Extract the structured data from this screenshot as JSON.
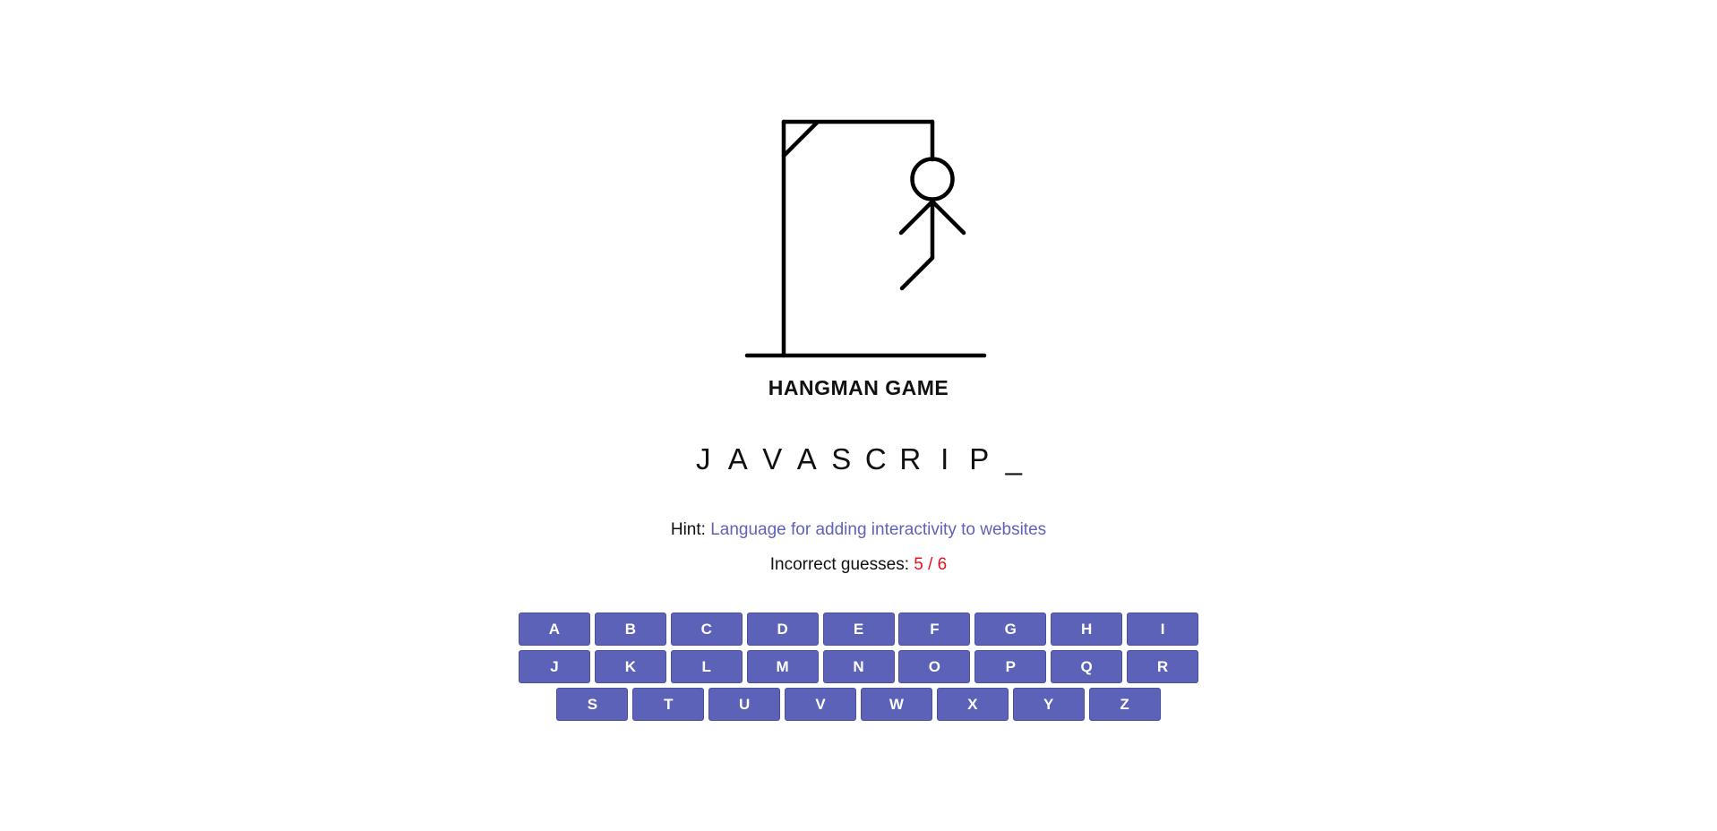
{
  "title": "HANGMAN GAME",
  "word": [
    "J",
    "A",
    "V",
    "A",
    "S",
    "C",
    "R",
    "I",
    "P",
    "_"
  ],
  "hint": {
    "label": "Hint:",
    "text": "Language for adding interactivity to websites"
  },
  "guesses": {
    "label": "Incorrect guesses:",
    "value": "5 / 6"
  },
  "keyboard": {
    "rows": [
      [
        "A",
        "B",
        "C",
        "D",
        "E",
        "F",
        "G",
        "H",
        "I"
      ],
      [
        "J",
        "K",
        "L",
        "M",
        "N",
        "O",
        "P",
        "Q",
        "R"
      ],
      [
        "S",
        "T",
        "U",
        "V",
        "W",
        "X",
        "Y",
        "Z"
      ]
    ]
  },
  "colors": {
    "key_background": "#5d62b9",
    "hint_text": "#5e63b8",
    "incorrect_count": "#e8101a"
  }
}
